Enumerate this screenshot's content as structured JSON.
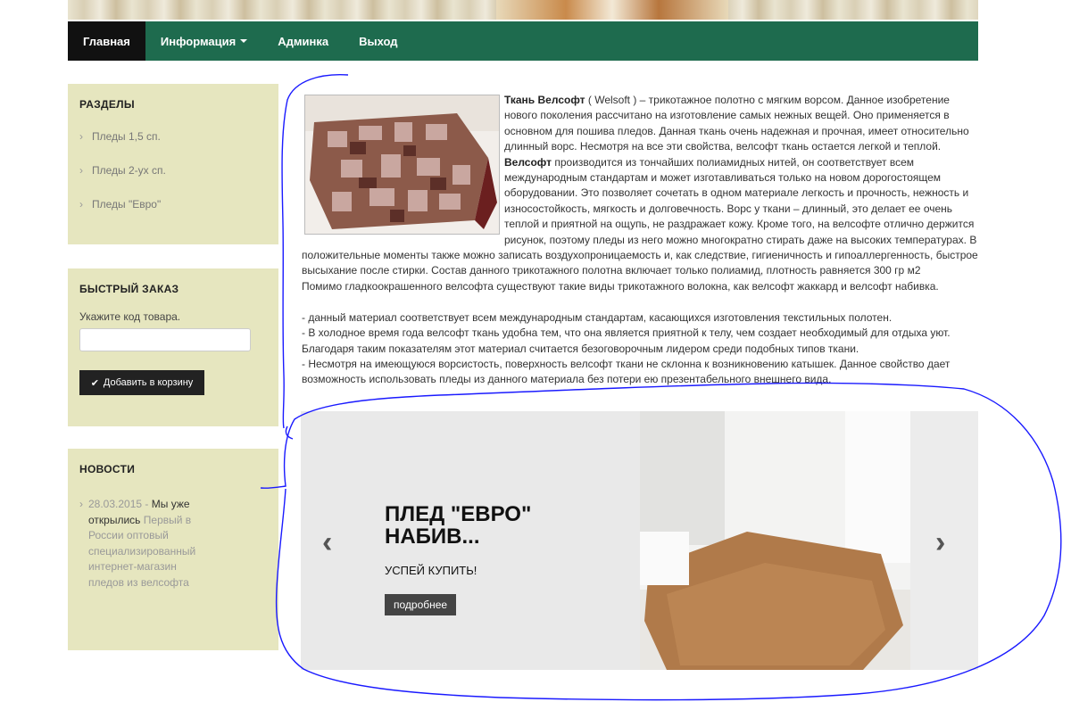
{
  "nav": {
    "items": [
      {
        "label": "Главная"
      },
      {
        "label": "Информация"
      },
      {
        "label": "Админка"
      },
      {
        "label": "Выход"
      }
    ]
  },
  "sidebar": {
    "sections": {
      "title": "РАЗДЕЛЫ",
      "items": [
        "Пледы 1,5 сп.",
        "Пледы 2-ух сп.",
        "Пледы \"Евро\""
      ]
    },
    "quick_order": {
      "title": "БЫСТРЫЙ ЗАКАЗ",
      "label": "Укажите код товара.",
      "input_value": "",
      "button_label": "Добавить в корзину"
    },
    "news": {
      "title": "НОВОСТИ",
      "date": "28.03.2015 -",
      "headline": "Мы уже открылись",
      "body": "Первый в России оптовый специализированный интернет-магазин пледов из велсофта"
    }
  },
  "article": {
    "title_bold": "Ткань Велсофт",
    "intro": " ( Welsoft ) – трикотажное полотно с мягким ворсом. Данное изобретение нового поколения рассчитано на изготовление самых нежных вещей. Оно применяется в основном для пошива пледов.  Данная ткань очень надежная и прочная, имеет относительно длинный ворс. Несмотря на все эти свойства, велсофт ткань остается легкой и теплой. ",
    "bold2": "Велсофт",
    "para1_rest": " производится из тончайших полиамидных нитей, он соответствует всем международным стандартам и может изготавливаться только на новом дорогостоящем оборудовании. Это позволяет сочетать в одном материале легкость и прочность, нежность и износостойкость, мягкость и долговечность. Ворс у ткани – длинный, это делает ее очень теплой и приятной на ощупь, не раздражает кожу. Кроме того, на велсофте отлично держится рисунок, поэтому пледы из него можно многократно стирать даже на высоких температурах. В положительные моменты также можно записать воздухопроницаемость и, как следствие, гигиеничность и гипоаллергенность, быстрое высыхание после стирки. Состав данного трикотажного полотна включает только полиамид, плотность равняется 300 гр м2",
    "para2": "Помимо гладкоокрашенного велсофта существуют такие виды трикотажного волокна, как велсофт жаккард и велсофт набивка.",
    "bullet1": "-  данный  материал соответствует всем международным стандартам, касающихся изготовления текстильных полотен.",
    "bullet2": "- В холодное время года велсофт ткань удобна тем, что она является приятной к телу, чем создает необходимый для отдыха уют. Благодаря таким показателям этот материал считается безоговорочным лидером среди подобных типов ткани.",
    "bullet3": "- Несмотря на имеющуюся ворсистость, поверхность велсофт ткани не склонна к возникновению катышек. Данное свойство дает возможность использовать пледы из данного материала без потери ею презентабельного внешнего вида."
  },
  "slider": {
    "title": "ПЛЕД \"ЕВРО\" НАБИВ...",
    "subtitle": "УСПЕЙ КУПИТЬ!",
    "button_label": "подробнее",
    "prev_glyph": "‹",
    "next_glyph": "›"
  },
  "colors": {
    "nav_bg": "#1e6b4e",
    "sidebar_bg": "#e6e6bf",
    "annotation_ink": "#1a1aff"
  }
}
